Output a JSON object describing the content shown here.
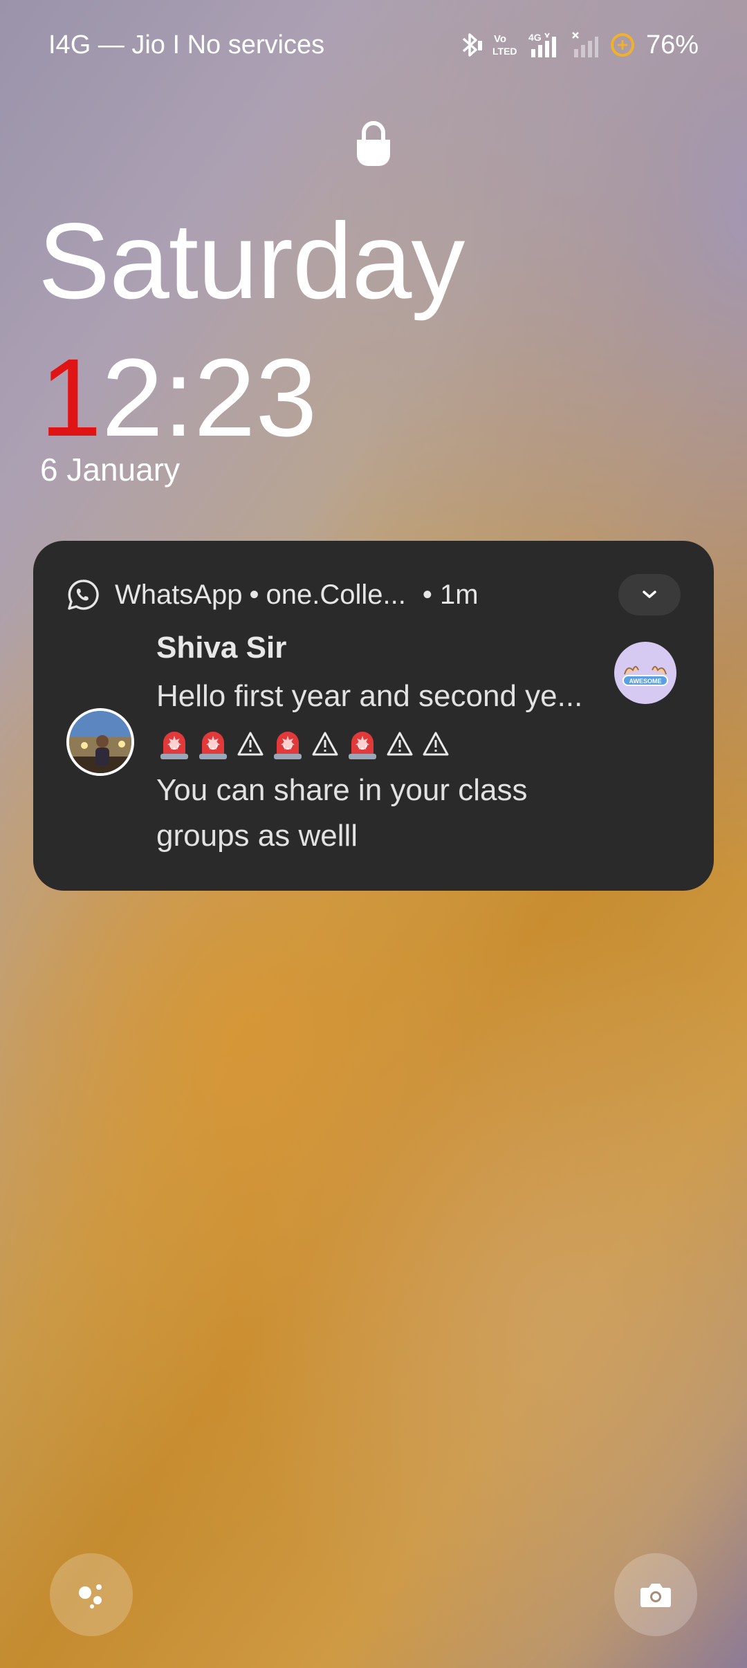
{
  "status_bar": {
    "carrier_text": "Ι4G — Jio I No services",
    "battery_percent": "76%",
    "icons": [
      "bluetooth-icon",
      "volte-icon",
      "signal-4g-icon",
      "signal-no-service-icon",
      "battery-saver-icon"
    ]
  },
  "lockscreen": {
    "lock_icon": "lock-open-icon",
    "day": "Saturday",
    "time_first_digit": "1",
    "time_rest": "2:23",
    "date": "6 January",
    "accent_color": "#e01414"
  },
  "notification": {
    "app_name": "WhatsApp",
    "group_name": "one.Colle...",
    "separator": "•",
    "time_ago": "• 1m",
    "sender": "Shiva Sir",
    "message_line1": "Hello first year and second  ye...",
    "emoji_sequence": [
      "siren",
      "siren",
      "warning",
      "siren",
      "warning",
      "siren",
      "warning",
      "warning"
    ],
    "message_line3": "You can share in your class",
    "message_line4": "groups as welll",
    "background_color": "#2a2a2b"
  },
  "shortcuts": {
    "left": "assistant-icon",
    "right": "camera-icon"
  }
}
